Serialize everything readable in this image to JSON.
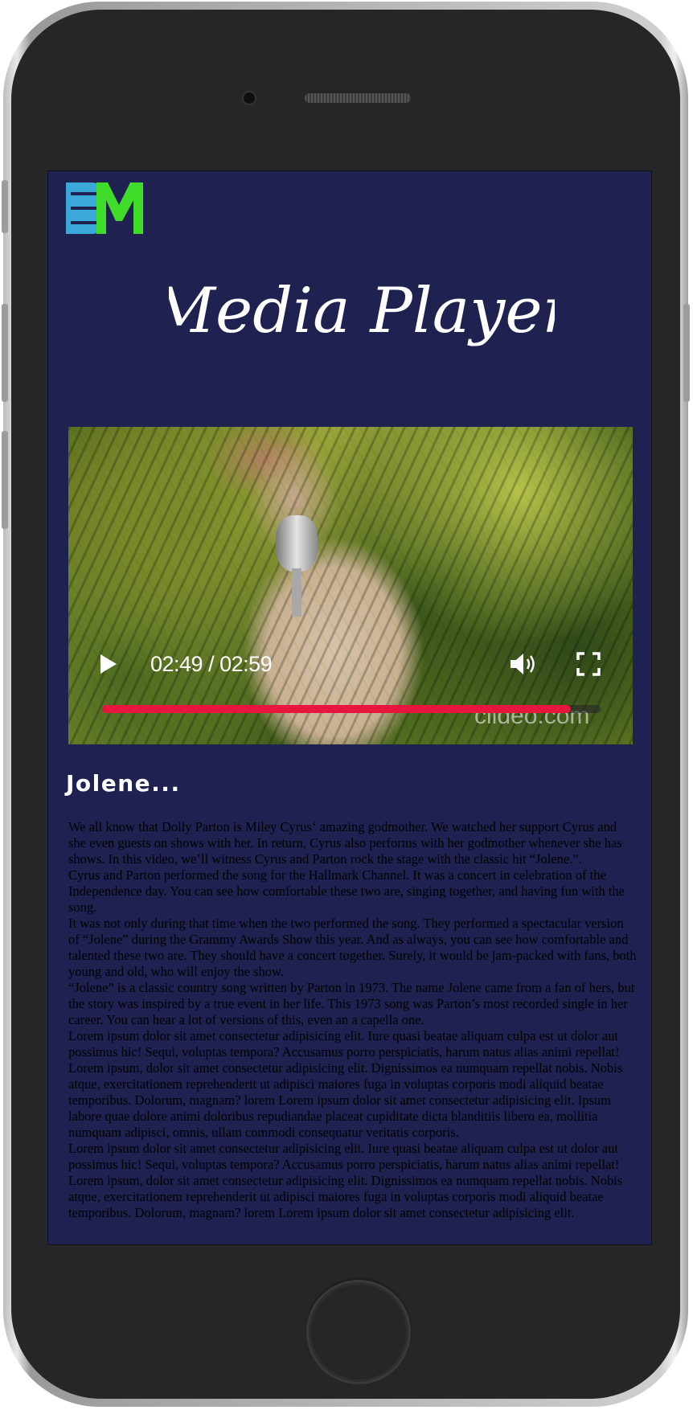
{
  "brand": {
    "logo_text": "BM",
    "logo_colors": {
      "b": "#3aa8d8",
      "m": "#3fdc2a"
    }
  },
  "header": {
    "title": "Media Player"
  },
  "video": {
    "current_time": "02:49",
    "duration": "02:59",
    "time_display": "02:49 / 02:59",
    "progress_fraction": 0.94,
    "watermark": "clideo.com",
    "progress_color": "#e8153f",
    "icons": {
      "play": "play-icon",
      "volume": "volume-icon",
      "fullscreen": "fullscreen-icon"
    }
  },
  "song": {
    "title": "Jolene..."
  },
  "article": {
    "paragraphs": [
      "We all know that Dolly Parton is Miley Cyrus‘ amazing godmother. We watched her support Cyrus and she even guests on shows with her. In return, Cyrus also performs with her godmother whenever she has shows. In this video, we’ll witness Cyrus and Parton rock the stage with the classic hit “Jolene.”.",
      "Cyrus and Parton performed the song for the Hallmark Channel. It was a concert in celebration of the Independence day. You can see how comfortable these two are, singing together, and having fun with the song.",
      "It was not only during that time when the two performed the song. They performed a spectacular version of “Jolene” during the Grammy Awards Show this year. And as always, you can see how comfortable and talented these two are. They should have a concert together. Surely, it would be jam-packed with fans, both young and old, who will enjoy the show.",
      "“Jolene” is a classic country song written by Parton in 1973. The name Jolene came from a fan of hers, but the story was inspired by a true event in her life. This 1973 song was Parton’s most recorded single in her career. You can hear a lot of versions of this, even an a capella one.",
      "Lorem ipsum dolor sit amet consectetur adipisicing elit. Iure quasi beatae aliquam culpa est ut dolor aut possimus hic! Sequi, voluptas tempora? Accusamus porro perspiciatis, harum natus alias animi repellat! Lorem ipsum, dolor sit amet consectetur adipisicing elit. Dignissimos ea numquam repellat nobis. Nobis atque, exercitationem reprehenderit ut adipisci maiores fuga in voluptas corporis modi aliquid beatae temporibus. Dolorum, magnam? lorem Lorem ipsum dolor sit amet consectetur adipisicing elit. Ipsum labore quae dolore animi doloribus repudiandae placeat cupiditate dicta blanditiis libero ea, mollitia numquam adipisci, omnis, ullam commodi consequatur veritatis corporis.",
      "Lorem ipsum dolor sit amet consectetur adipisicing elit. Iure quasi beatae aliquam culpa est ut dolor aut possimus hic! Sequi, voluptas tempora? Accusamus porro perspiciatis, harum natus alias animi repellat! Lorem ipsum, dolor sit amet consectetur adipisicing elit. Dignissimos ea numquam repellat nobis. Nobis atque, exercitationem reprehenderit ut adipisci maiores fuga in voluptas corporis modi aliquid beatae temporibus. Dolorum, magnam? lorem Lorem ipsum dolor sit amet consectetur adipisicing elit."
    ]
  },
  "theme": {
    "screen_bg": "#1f2150",
    "text_color": "#000000"
  }
}
